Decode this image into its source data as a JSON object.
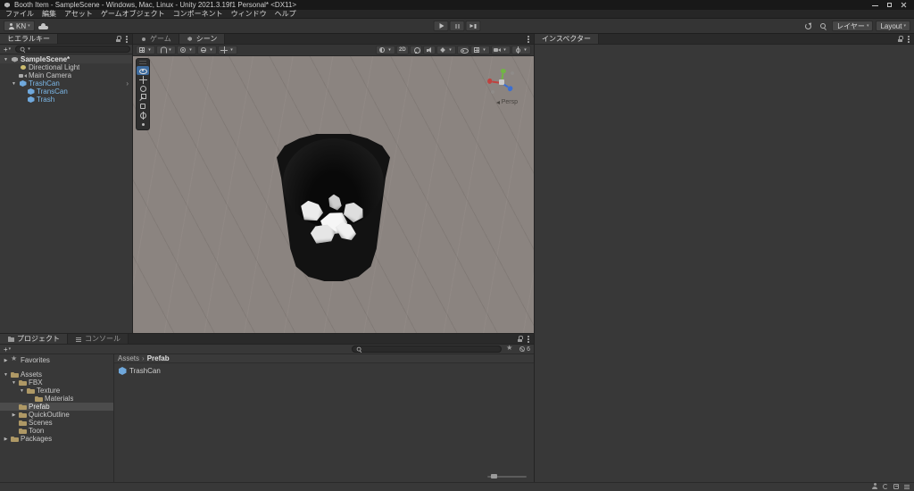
{
  "window": {
    "title": "Booth Item - SampleScene - Windows, Mac, Linux - Unity 2021.3.19f1 Personal* <DX11>",
    "controls": [
      {
        "icon": "minimize-icon"
      },
      {
        "icon": "maximize-icon"
      },
      {
        "icon": "close-icon"
      }
    ]
  },
  "menu": {
    "items": [
      "ファイル",
      "編集",
      "アセット",
      "ゲームオブジェクト",
      "コンポーネント",
      "ウィンドウ",
      "ヘルプ"
    ]
  },
  "toolbar": {
    "account_label": "KN",
    "layers_label": "レイヤー",
    "layout_label": "Layout",
    "play_controls": [
      {
        "icon": "play-icon"
      },
      {
        "icon": "pause-icon"
      },
      {
        "icon": "step-icon"
      }
    ]
  },
  "hierarchy": {
    "tab_label": "ヒエラルキー",
    "items": [
      {
        "label": "SampleScene*",
        "caret": "▼",
        "icon": "scene-icon",
        "type": "scene",
        "depth": 0
      },
      {
        "label": "Directional Light",
        "icon": "light-icon",
        "type": "object",
        "depth": 1
      },
      {
        "label": "Main Camera",
        "icon": "camera-icon",
        "type": "object",
        "depth": 1
      },
      {
        "label": "TrashCan",
        "caret": "▼",
        "icon": "prefab-icon",
        "type": "prefab",
        "depth": 1,
        "more": "›"
      },
      {
        "label": "TransCan",
        "icon": "prefab-icon",
        "type": "prefab",
        "depth": 2
      },
      {
        "label": "Trash",
        "icon": "prefab-icon",
        "type": "prefab",
        "depth": 2
      }
    ]
  },
  "scene": {
    "tabs": [
      {
        "label": "ゲーム",
        "icon": "game-tab-icon"
      },
      {
        "label": "シーン",
        "icon": "scene-tab-icon",
        "active": true
      }
    ],
    "left_tools": [
      {
        "icon": "grid-icon",
        "caret": true
      },
      {
        "icon": "snap-icon",
        "caret": true
      },
      {
        "icon": "pivot-icon",
        "caret": true
      },
      {
        "icon": "axis-icon",
        "caret": true
      },
      {
        "icon": "move-snap-icon",
        "caret": true
      }
    ],
    "right_tools": [
      {
        "icon": "shading-icon",
        "caret": true
      },
      {
        "icon": "twod-icon"
      },
      {
        "icon": "lighting-icon"
      },
      {
        "icon": "audio-icon"
      },
      {
        "icon": "effects-icon",
        "caret": true
      },
      {
        "icon": "visibility-icon"
      },
      {
        "icon": "gridvis-icon",
        "caret": true
      },
      {
        "icon": "cameradd-icon",
        "caret": true
      },
      {
        "icon": "gizmos-icon",
        "caret": true
      }
    ],
    "tool_palette": [
      {
        "icon": "view-tool-icon",
        "selected": true
      },
      {
        "icon": "move-tool-icon"
      },
      {
        "icon": "rotate-tool-icon"
      },
      {
        "icon": "scale-tool-icon"
      },
      {
        "icon": "rect-tool-icon"
      },
      {
        "icon": "transform-tool-icon"
      },
      {
        "icon": "custom-tool-icon"
      }
    ],
    "gizmo_label": "Persp"
  },
  "inspector": {
    "tab_label": "インスペクター"
  },
  "project": {
    "tabs": [
      {
        "label": "プロジェクト",
        "icon": "project-tab-icon",
        "active": true
      },
      {
        "label": "コンソール",
        "icon": "console-tab-icon"
      }
    ],
    "toolbar_icons": [
      {
        "icon": "search-save-icon"
      },
      {
        "icon": "hidden-packages-icon",
        "label": "6"
      }
    ],
    "tree": [
      {
        "label": "Favorites",
        "caret": "▶",
        "icon": "star-icon",
        "depth": 0
      },
      {
        "label": "Assets",
        "caret": "▼",
        "icon": "folder-icon",
        "depth": 0,
        "gap": true
      },
      {
        "label": "FBX",
        "caret": "▼",
        "icon": "folder-icon",
        "depth": 1
      },
      {
        "label": "Texture",
        "caret": "▼",
        "icon": "folder-icon",
        "depth": 2
      },
      {
        "label": "Materials",
        "icon": "folder-icon",
        "depth": 3
      },
      {
        "label": "Prefab",
        "icon": "folder-icon",
        "depth": 1,
        "selected": true
      },
      {
        "label": "QuickOutline",
        "caret": "▶",
        "icon": "folder-icon",
        "depth": 1
      },
      {
        "label": "Scenes",
        "icon": "folder-icon",
        "depth": 1
      },
      {
        "label": "Toon",
        "icon": "folder-icon",
        "depth": 1
      },
      {
        "label": "Packages",
        "caret": "▶",
        "icon": "folder-icon",
        "depth": 0
      }
    ],
    "breadcrumb": {
      "root": "Assets",
      "sep": "›",
      "current": "Prefab"
    },
    "items": [
      {
        "label": "TrashCan",
        "icon": "prefab-icon"
      }
    ]
  },
  "status": {
    "icons": [
      {
        "icon": "collab-status-icon"
      },
      {
        "icon": "progress-status-icon"
      },
      {
        "icon": "console-status-icon"
      },
      {
        "icon": "menu-status-icon"
      }
    ]
  }
}
